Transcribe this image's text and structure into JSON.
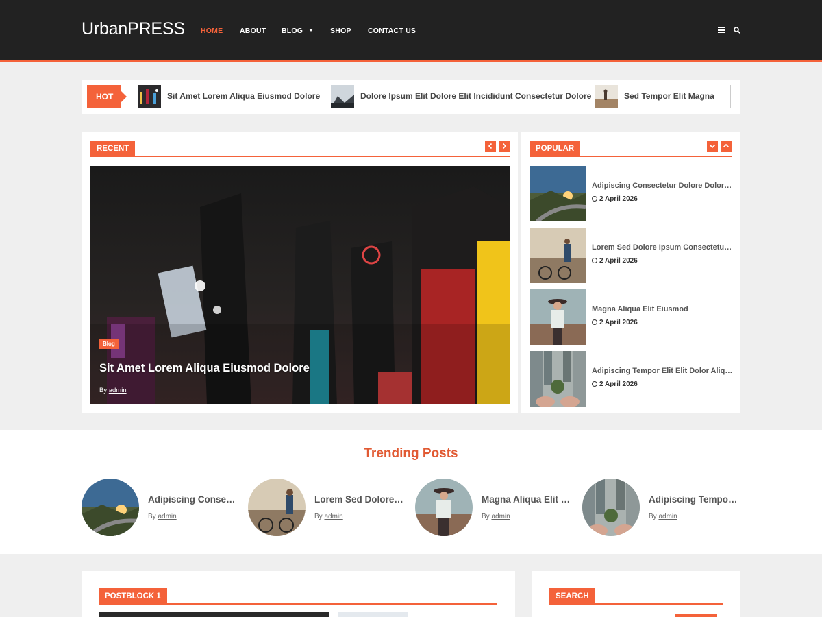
{
  "site": {
    "logo": "UrbanPRESS",
    "accent": "#f4623a"
  },
  "nav": [
    {
      "label": "HOME",
      "active": true
    },
    {
      "label": "ABOUT"
    },
    {
      "label": "BLOG",
      "has_dropdown": true
    },
    {
      "label": "SHOP"
    },
    {
      "label": "CONTACT US"
    }
  ],
  "header_icons": [
    "menu-icon",
    "search-icon"
  ],
  "ticker": {
    "label": "HOT",
    "items": [
      {
        "title": "Sit Amet Lorem Aliqua Eiusmod Dolore"
      },
      {
        "title": "Dolore Ipsum Elit Dolore Elit Incididunt Consectetur Dolore"
      },
      {
        "title": "Sed Tempor Elit Magna"
      }
    ]
  },
  "recent": {
    "label": "RECENT",
    "hero": {
      "tag": "Blog",
      "title": "Sit Amet Lorem Aliqua Eiusmod Dolore",
      "by": "By",
      "author": "admin"
    }
  },
  "popular": {
    "label": "POPULAR",
    "items": [
      {
        "title": "Adipiscing Consectetur Dolore Dolor Elit",
        "date": "2 April 2026"
      },
      {
        "title": "Lorem Sed Dolore Ipsum Consectetur Sed",
        "date": "2 April 2026"
      },
      {
        "title": "Magna Aliqua Elit Eiusmod",
        "date": "2 April 2026"
      },
      {
        "title": "Adipiscing Tempor Elit Elit Dolor Aliqua",
        "date": "2 April 2026"
      }
    ]
  },
  "trending": {
    "title": "Trending Posts",
    "items": [
      {
        "title": "Adipiscing Consectetur Dolore",
        "by": "By",
        "author": "admin"
      },
      {
        "title": "Lorem Sed Dolore Ipsum",
        "by": "By",
        "author": "admin"
      },
      {
        "title": "Magna Aliqua Elit Eiusmod",
        "by": "By",
        "author": "admin"
      },
      {
        "title": "Adipiscing Tempor Elit",
        "by": "By",
        "author": "admin"
      }
    ]
  },
  "postblock": {
    "label": "POSTBLOCK 1"
  },
  "search_widget": {
    "label": "SEARCH"
  }
}
